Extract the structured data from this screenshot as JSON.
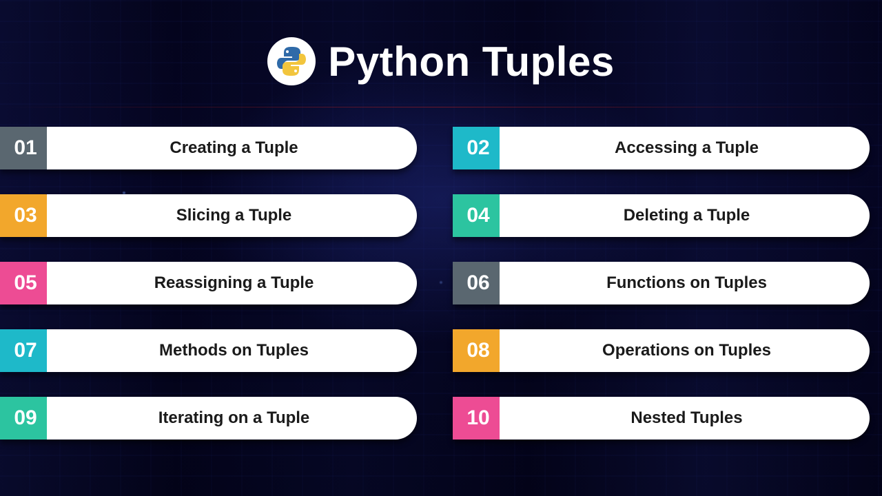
{
  "title": "Python Tuples",
  "logo_name": "python-logo-icon",
  "colors": {
    "slate": "#5a6770",
    "cyan": "#1eb9c9",
    "orange": "#f2a72c",
    "teal": "#2cc4a0",
    "pink": "#ed4c94"
  },
  "items": [
    {
      "num": "01",
      "label": "Creating a Tuple",
      "colorKey": "slate"
    },
    {
      "num": "02",
      "label": "Accessing a Tuple",
      "colorKey": "cyan"
    },
    {
      "num": "03",
      "label": "Slicing a Tuple",
      "colorKey": "orange"
    },
    {
      "num": "04",
      "label": "Deleting a Tuple",
      "colorKey": "teal"
    },
    {
      "num": "05",
      "label": "Reassigning a Tuple",
      "colorKey": "pink"
    },
    {
      "num": "06",
      "label": "Functions on Tuples",
      "colorKey": "slate"
    },
    {
      "num": "07",
      "label": "Methods on Tuples",
      "colorKey": "cyan"
    },
    {
      "num": "08",
      "label": "Operations on Tuples",
      "colorKey": "orange"
    },
    {
      "num": "09",
      "label": "Iterating on a Tuple",
      "colorKey": "teal"
    },
    {
      "num": "10",
      "label": "Nested Tuples",
      "colorKey": "pink"
    }
  ]
}
